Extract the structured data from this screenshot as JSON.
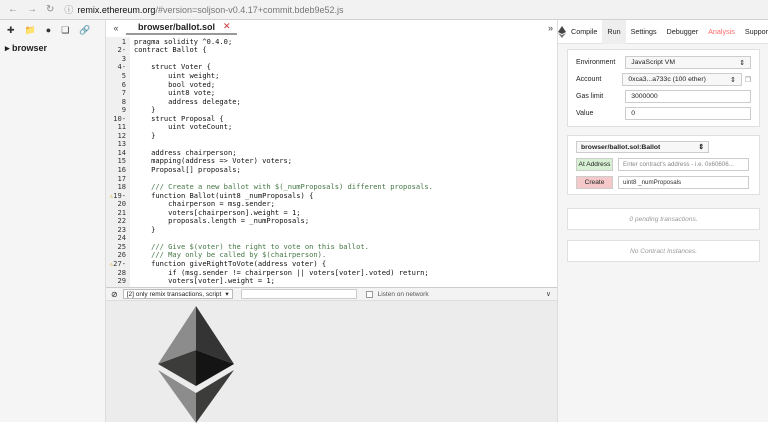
{
  "browser": {
    "url_host": "remix.ethereum.org",
    "url_rest": "/#version=soljson-v0.4.17+commit.bdeb9e52.js"
  },
  "explorer": {
    "folder": "browser"
  },
  "editor": {
    "tab_name": "browser/ballot.sol",
    "lines": [
      {
        "n": "1",
        "fold": "",
        "warn": false,
        "code": "pragma solidity ^0.4.0;"
      },
      {
        "n": "2",
        "fold": "-",
        "warn": false,
        "code": "contract Ballot {"
      },
      {
        "n": "3",
        "fold": "",
        "warn": false,
        "code": ""
      },
      {
        "n": "4",
        "fold": "-",
        "warn": false,
        "code": "    struct Voter {"
      },
      {
        "n": "5",
        "fold": "",
        "warn": false,
        "code": "        uint weight;"
      },
      {
        "n": "6",
        "fold": "",
        "warn": false,
        "code": "        bool voted;"
      },
      {
        "n": "7",
        "fold": "",
        "warn": false,
        "code": "        uint8 vote;"
      },
      {
        "n": "8",
        "fold": "",
        "warn": false,
        "code": "        address delegate;"
      },
      {
        "n": "9",
        "fold": "",
        "warn": false,
        "code": "    }"
      },
      {
        "n": "10",
        "fold": "-",
        "warn": false,
        "code": "    struct Proposal {"
      },
      {
        "n": "11",
        "fold": "",
        "warn": false,
        "code": "        uint voteCount;"
      },
      {
        "n": "12",
        "fold": "",
        "warn": false,
        "code": "    }"
      },
      {
        "n": "13",
        "fold": "",
        "warn": false,
        "code": ""
      },
      {
        "n": "14",
        "fold": "",
        "warn": false,
        "code": "    address chairperson;"
      },
      {
        "n": "15",
        "fold": "",
        "warn": false,
        "code": "    mapping(address => Voter) voters;"
      },
      {
        "n": "16",
        "fold": "",
        "warn": false,
        "code": "    Proposal[] proposals;"
      },
      {
        "n": "17",
        "fold": "",
        "warn": false,
        "code": ""
      },
      {
        "n": "18",
        "fold": "",
        "warn": false,
        "code": "    /// Create a new ballot with $(_numProposals) different proposals."
      },
      {
        "n": "19",
        "fold": "-",
        "warn": true,
        "code": "    function Ballot(uint8 _numProposals) {"
      },
      {
        "n": "20",
        "fold": "",
        "warn": false,
        "code": "        chairperson = msg.sender;"
      },
      {
        "n": "21",
        "fold": "",
        "warn": false,
        "code": "        voters[chairperson].weight = 1;"
      },
      {
        "n": "22",
        "fold": "",
        "warn": false,
        "code": "        proposals.length = _numProposals;"
      },
      {
        "n": "23",
        "fold": "",
        "warn": false,
        "code": "    }"
      },
      {
        "n": "24",
        "fold": "",
        "warn": false,
        "code": ""
      },
      {
        "n": "25",
        "fold": "",
        "warn": false,
        "code": "    /// Give $(voter) the right to vote on this ballot."
      },
      {
        "n": "26",
        "fold": "",
        "warn": false,
        "code": "    /// May only be called by $(chairperson)."
      },
      {
        "n": "27",
        "fold": "-",
        "warn": true,
        "code": "    function giveRightToVote(address voter) {"
      },
      {
        "n": "28",
        "fold": "",
        "warn": false,
        "code": "        if (msg.sender != chairperson || voters[voter].voted) return;"
      },
      {
        "n": "29",
        "fold": "",
        "warn": false,
        "code": "        voters[voter].weight = 1;"
      }
    ]
  },
  "terminal": {
    "filter_select": "[2] only remix transactions, script",
    "listen_label": "Listen on network"
  },
  "right_panel": {
    "tabs": [
      "Compile",
      "Run",
      "Settings",
      "Debugger",
      "Analysis",
      "Support"
    ],
    "active_tab": "Run",
    "environment_label": "Environment",
    "environment_value": "JavaScript VM",
    "account_label": "Account",
    "account_value": "0xca3...a733c (100 ether)",
    "gas_label": "Gas limit",
    "gas_value": "3000000",
    "value_label": "Value",
    "value_value": "0",
    "contract_select": "browser/ballot.sol:Ballot",
    "at_address_label": "At Address",
    "at_address_placeholder": "Enter contract's address - i.e. 0x60606...",
    "create_label": "Create",
    "create_args": "uint8 _numProposals",
    "pending_text": "0 pending transactions.",
    "no_instances_text": "No Contract Instances."
  },
  "colors": {
    "eth_logo_dark": "#343434",
    "eth_logo_mid": "#8c8c8c",
    "eth_logo_light": "#3c3c3b",
    "analysis_tab": "#ff6b6b"
  }
}
